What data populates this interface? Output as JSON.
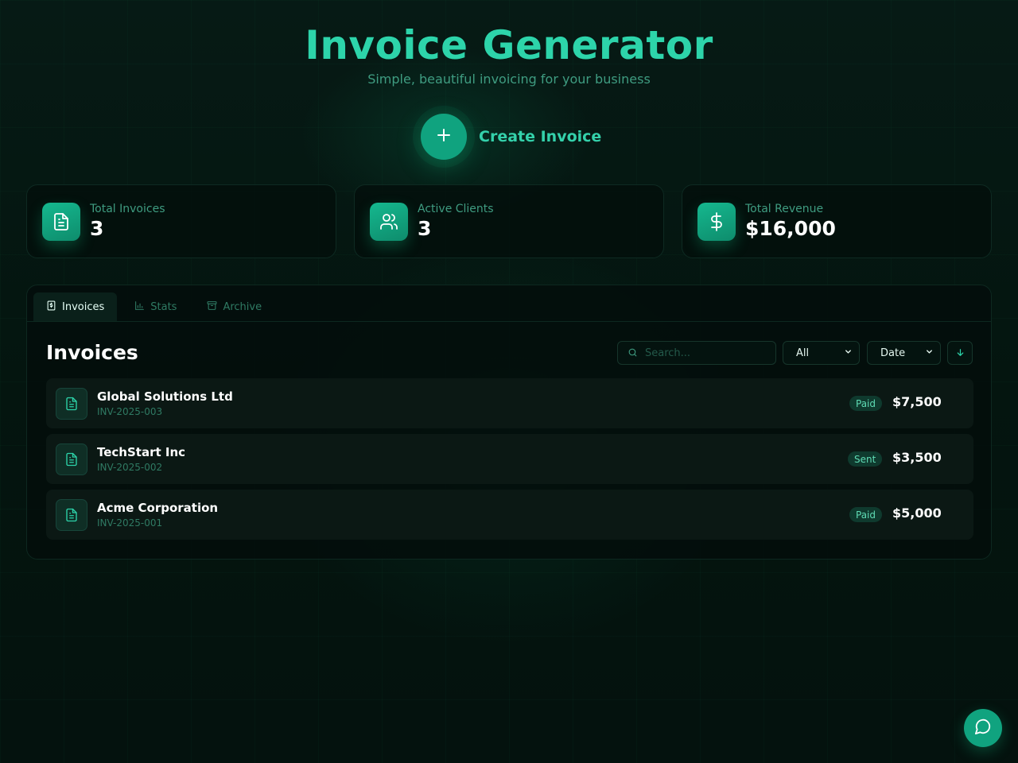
{
  "header": {
    "title": "Invoice Generator",
    "subtitle": "Simple, beautiful invoicing for your business",
    "create_label": "Create Invoice",
    "create_icon": "plus-icon"
  },
  "stats": [
    {
      "label": "Total Invoices",
      "value": "3",
      "icon": "document-icon"
    },
    {
      "label": "Active Clients",
      "value": "3",
      "icon": "users-icon"
    },
    {
      "label": "Total Revenue",
      "value": "$16,000",
      "icon": "dollar-icon"
    }
  ],
  "tabs": [
    {
      "label": "Invoices",
      "icon": "invoice-icon",
      "active": true
    },
    {
      "label": "Stats",
      "icon": "bar-chart-icon",
      "active": false
    },
    {
      "label": "Archive",
      "icon": "archive-icon",
      "active": false
    }
  ],
  "invoices_panel": {
    "title": "Invoices",
    "search_placeholder": "Search...",
    "status_filter": "All",
    "sort_by": "Date",
    "sort_direction_icon": "arrow-down-icon"
  },
  "invoices": [
    {
      "client": "Global Solutions Ltd",
      "number": "INV-2025-003",
      "status": "Paid",
      "amount": "$7,500"
    },
    {
      "client": "TechStart Inc",
      "number": "INV-2025-002",
      "status": "Sent",
      "amount": "$3,500"
    },
    {
      "client": "Acme Corporation",
      "number": "INV-2025-001",
      "status": "Paid",
      "amount": "$5,000"
    }
  ],
  "chat": {
    "icon": "chat-bubble-icon"
  },
  "colors": {
    "accent": "#10a37f",
    "accent_text": "#2dd4aa",
    "background": "#04130f",
    "muted_text": "#3f9c81"
  }
}
